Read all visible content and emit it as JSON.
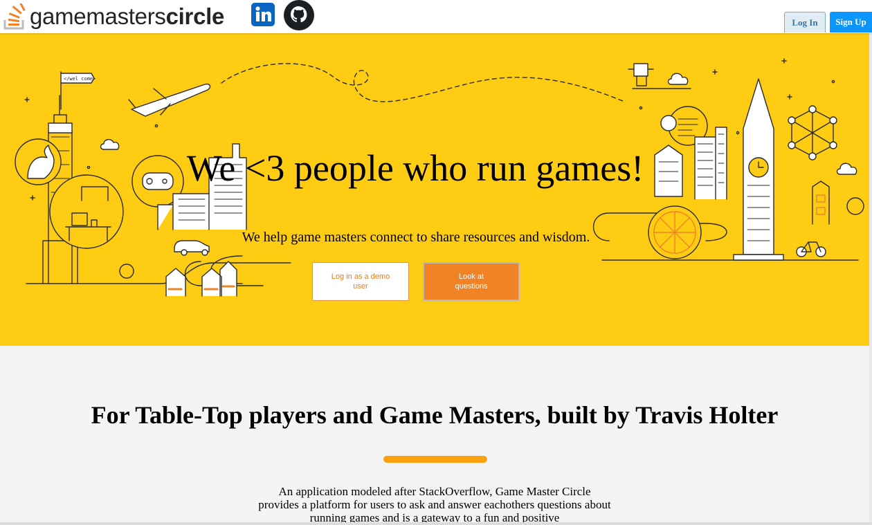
{
  "header": {
    "brand_light": "gamemasters",
    "brand_bold": "circle",
    "linkedin_icon": "linkedin-icon",
    "github_icon": "github-icon",
    "login_label": "Log In",
    "signup_label": "Sign Up"
  },
  "hero": {
    "title": "We <3 people who run games!",
    "subtitle": "We help game masters connect to share resources and wisdom.",
    "demo_button": "Log in as a demo user",
    "questions_button": "Look at questions",
    "flag_text": "</wel come>",
    "background_color": "#fecc12"
  },
  "info": {
    "title": "For Table-Top players and Game Masters, built by Travis Holter",
    "body": "An application modeled after StackOverflow, Game Master Circle provides a platform for users to ask and answer eachothers questions about running games and is a gateway to a fun and positive",
    "accent_color": "#f8a20f"
  },
  "colors": {
    "brand_orange": "#f48024",
    "signup_blue": "#0a95ff",
    "login_bg": "#e1ecf4"
  }
}
